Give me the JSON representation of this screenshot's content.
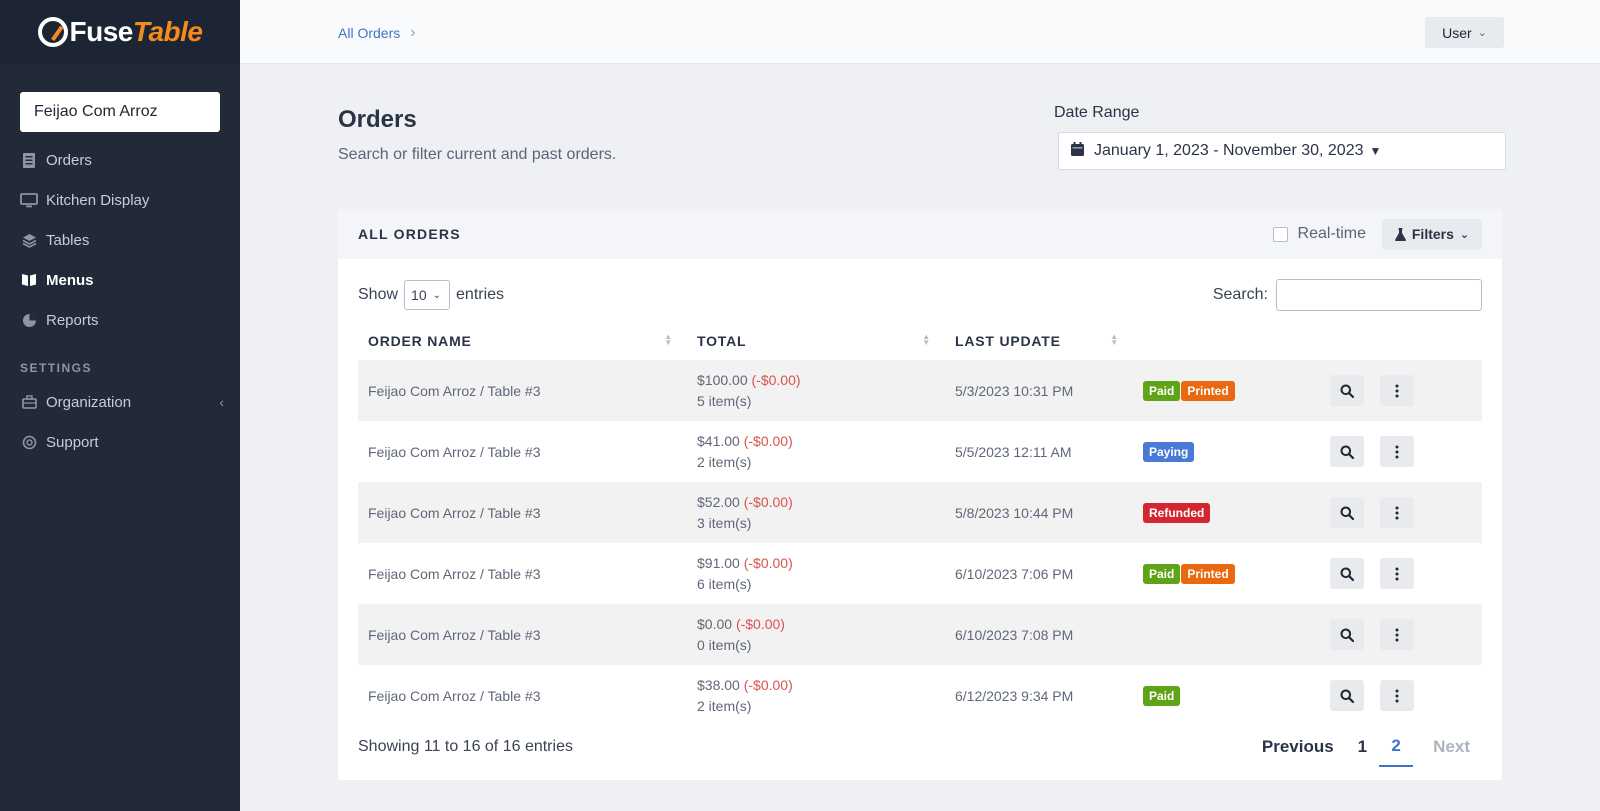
{
  "brand": {
    "fuse": "Fuse",
    "table": "Table"
  },
  "sidebar": {
    "org": "Feijao Com Arroz",
    "items": [
      {
        "label": "Orders",
        "icon": "orders-icon",
        "active": false
      },
      {
        "label": "Kitchen Display",
        "icon": "monitor-icon",
        "active": false
      },
      {
        "label": "Tables",
        "icon": "layers-icon",
        "active": false
      },
      {
        "label": "Menus",
        "icon": "book-icon",
        "active": true
      },
      {
        "label": "Reports",
        "icon": "pie-chart-icon",
        "active": false
      }
    ],
    "settings_label": "SETTINGS",
    "settings_items": [
      {
        "label": "Organization",
        "icon": "briefcase-icon"
      },
      {
        "label": "Support",
        "icon": "lifebuoy-icon"
      }
    ]
  },
  "topbar": {
    "breadcrumb": "All Orders",
    "user": "User"
  },
  "header": {
    "title": "Orders",
    "subtitle": "Search or filter current and past orders.",
    "date_label": "Date Range",
    "date_value": "January 1, 2023 - November 30, 2023"
  },
  "card": {
    "title": "ALL ORDERS",
    "realtime": "Real-time",
    "filters": "Filters",
    "show": "Show",
    "entries_count": "10",
    "entries": "entries",
    "search": "Search:",
    "columns": [
      "ORDER NAME",
      "TOTAL",
      "LAST UPDATE"
    ],
    "rows": [
      {
        "name": "Feijao Com Arroz / Table #3",
        "total": "$100.00",
        "discount": "(-$0.00)",
        "items": "5 item(s)",
        "updated": "5/3/2023 10:31 PM",
        "badges": [
          "Paid",
          "Printed"
        ]
      },
      {
        "name": "Feijao Com Arroz / Table #3",
        "total": "$41.00",
        "discount": "(-$0.00)",
        "items": "2 item(s)",
        "updated": "5/5/2023 12:11 AM",
        "badges": [
          "Paying"
        ]
      },
      {
        "name": "Feijao Com Arroz / Table #3",
        "total": "$52.00",
        "discount": "(-$0.00)",
        "items": "3 item(s)",
        "updated": "5/8/2023 10:44 PM",
        "badges": [
          "Refunded"
        ]
      },
      {
        "name": "Feijao Com Arroz / Table #3",
        "total": "$91.00",
        "discount": "(-$0.00)",
        "items": "6 item(s)",
        "updated": "6/10/2023 7:06 PM",
        "badges": [
          "Paid",
          "Printed"
        ]
      },
      {
        "name": "Feijao Com Arroz / Table #3",
        "total": "$0.00",
        "discount": "(-$0.00)",
        "items": "0 item(s)",
        "updated": "6/10/2023 7:08 PM",
        "badges": []
      },
      {
        "name": "Feijao Com Arroz / Table #3",
        "total": "$38.00",
        "discount": "(-$0.00)",
        "items": "2 item(s)",
        "updated": "6/12/2023 9:34 PM",
        "badges": [
          "Paid"
        ]
      }
    ],
    "showing": "Showing 11 to 16 of 16 entries",
    "pager": {
      "previous": "Previous",
      "pages": [
        "1",
        "2"
      ],
      "current": "2",
      "next": "Next"
    }
  },
  "colors": {
    "sidebar": "#222a3a",
    "accent": "#3c76c5",
    "brand_orange": "#f58b1f",
    "paid": "#5fa316",
    "printed": "#e8690f",
    "paying": "#4a79d6",
    "refunded": "#d22630"
  }
}
